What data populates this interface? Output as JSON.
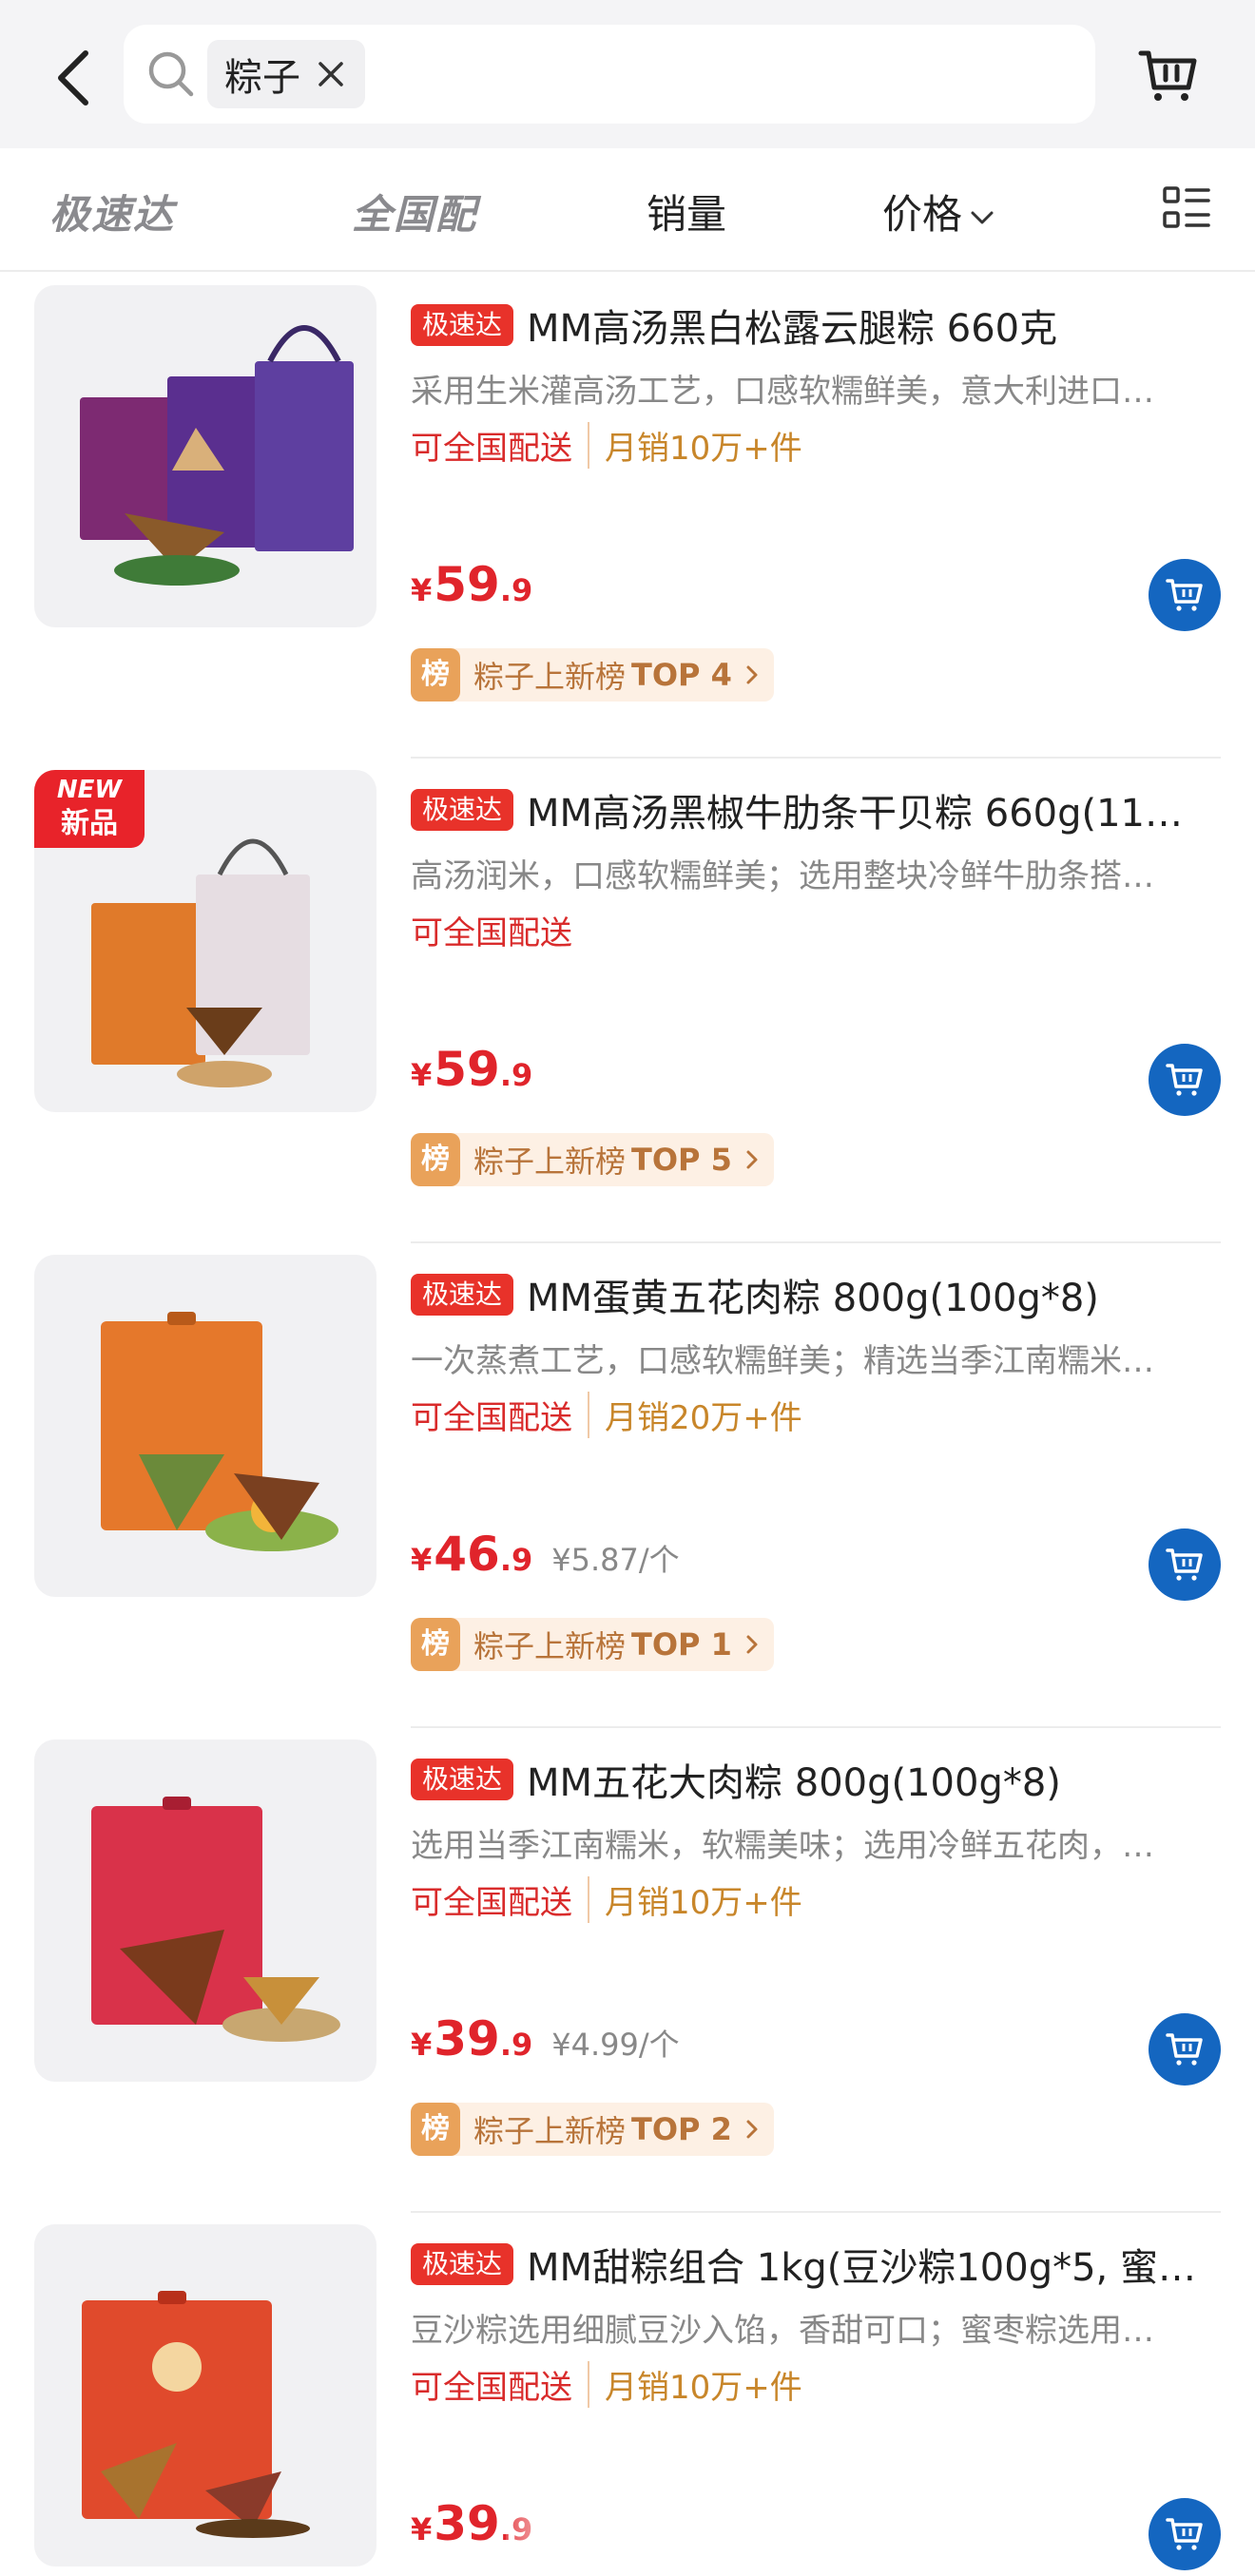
{
  "search": {
    "chip_text": "粽子"
  },
  "sortbar": {
    "brand_fast": "极速达",
    "brand_national": "全国配",
    "sales": "销量",
    "price": "价格"
  },
  "colors": {
    "accent_red": "#e0242b",
    "cart_blue": "#1466c0",
    "sales_orange": "#c8862a"
  },
  "products": [
    {
      "tag": "极速达",
      "title": "MM高汤黑白松露云腿粽 660克",
      "desc": "采用生米灌高汤工艺，口感软糯鲜美，意大利进口…",
      "ship": "可全国配送",
      "sales": "月销10万+件",
      "price_yen": "¥",
      "price_int": "59",
      "price_dec": ".9",
      "unit_price": "",
      "rank_icon": "榜",
      "rank_text": "粽子上新榜",
      "rank_top": "TOP 4",
      "is_new": false
    },
    {
      "tag": "极速达",
      "title": "MM高汤黑椒牛肋条干贝粽 660g(11…",
      "desc": "高汤润米，口感软糯鲜美；选用整块冷鲜牛肋条搭…",
      "ship": "可全国配送",
      "sales": "",
      "price_yen": "¥",
      "price_int": "59",
      "price_dec": ".9",
      "unit_price": "",
      "rank_icon": "榜",
      "rank_text": "粽子上新榜",
      "rank_top": "TOP 5",
      "is_new": true,
      "new_badge_en": "NEW",
      "new_badge_zh": "新品"
    },
    {
      "tag": "极速达",
      "title": "MM蛋黄五花肉粽 800g(100g*8)",
      "desc": "一次蒸煮工艺，口感软糯鲜美；精选当季江南糯米…",
      "ship": "可全国配送",
      "sales": "月销20万+件",
      "price_yen": "¥",
      "price_int": "46",
      "price_dec": ".9",
      "unit_price": "¥5.87/个",
      "rank_icon": "榜",
      "rank_text": "粽子上新榜",
      "rank_top": "TOP 1",
      "is_new": false
    },
    {
      "tag": "极速达",
      "title": "MM五花大肉粽 800g(100g*8)",
      "desc": "选用当季江南糯米，软糯美味；选用冷鲜五花肉，…",
      "ship": "可全国配送",
      "sales": "月销10万+件",
      "price_yen": "¥",
      "price_int": "39",
      "price_dec": ".9",
      "unit_price": "¥4.99/个",
      "rank_icon": "榜",
      "rank_text": "粽子上新榜",
      "rank_top": "TOP 2",
      "is_new": false
    },
    {
      "tag": "极速达",
      "title": "MM甜粽组合 1kg(豆沙粽100g*5, 蜜…",
      "desc": "豆沙粽选用细腻豆沙入馅，香甜可口；蜜枣粽选用…",
      "ship": "可全国配送",
      "sales": "月销10万+件",
      "price_yen": "¥",
      "price_int": "39",
      "price_dec": ".9",
      "unit_price": "",
      "rank_icon": "",
      "rank_text": "",
      "rank_top": "",
      "is_new": false
    }
  ],
  "icons": {
    "back": "chevron-left-icon",
    "search": "search-icon",
    "close": "close-icon",
    "cart": "shopping-cart-icon",
    "layout": "list-layout-icon",
    "add_cart": "cart-add-icon"
  }
}
